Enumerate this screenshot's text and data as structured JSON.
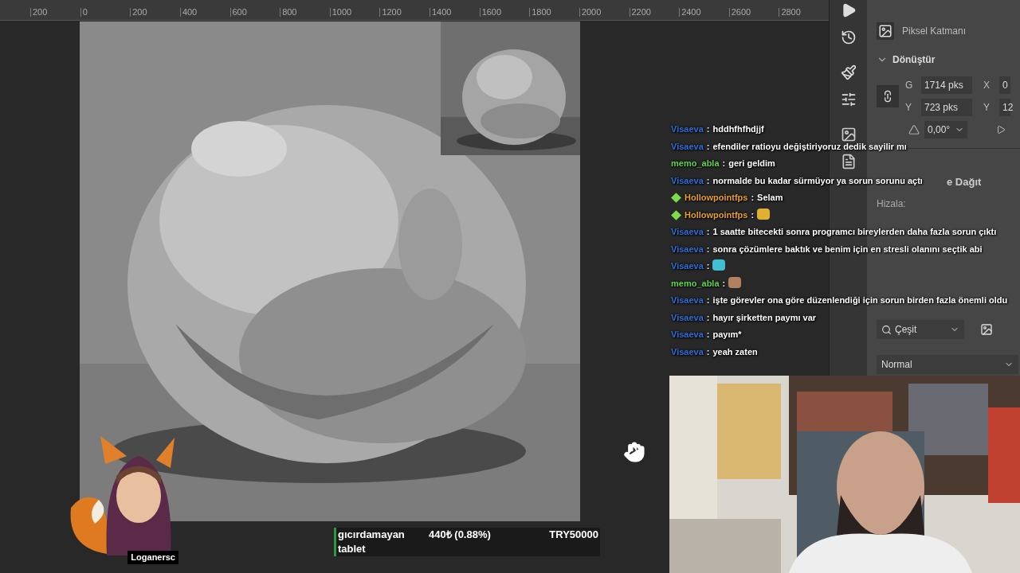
{
  "ruler": {
    "labels": [
      "200",
      "0",
      "200",
      "400",
      "600",
      "800",
      "1000",
      "1200",
      "1400",
      "1600",
      "1800",
      "2000",
      "2200",
      "2400",
      "2600",
      "2800"
    ]
  },
  "properties_panel": {
    "layer_type": "Piksel Katmanı",
    "transform": {
      "title": "Dönüştür",
      "expanded": true,
      "fields": [
        {
          "label": "G",
          "value": "1714 pks"
        },
        {
          "label": "X",
          "value": "0"
        },
        {
          "label": "Y",
          "value": "723 pks"
        },
        {
          "label": "Y",
          "value": "12"
        }
      ],
      "angle": "0,00°"
    },
    "align_title": "e Dağıt",
    "align_label": "Hizala:"
  },
  "layers_panel": {
    "filter": "Çeşit",
    "blend_mode": "Normal"
  },
  "chat": {
    "separator": ":",
    "messages": [
      {
        "user": "Visaeva",
        "color": "#2f6fd6",
        "badge": false,
        "kind": "text",
        "text": "hddhfhfhdjjf"
      },
      {
        "user": "Visaeva",
        "color": "#2f6fd6",
        "badge": false,
        "kind": "text",
        "text": "efendiler ratioyu değiştiriyoruz dedik sayilir mı"
      },
      {
        "user": "memo_abla",
        "color": "#5ed64a",
        "badge": false,
        "kind": "text",
        "text": "geri geldim"
      },
      {
        "user": "Visaeva",
        "color": "#2f6fd6",
        "badge": false,
        "kind": "text",
        "text": "normalde bu kadar sürmüyor ya sorun sorunu açtı"
      },
      {
        "user": "Hollowpointfps",
        "color": "#e8a030",
        "badge": true,
        "kind": "text",
        "text": "Selam"
      },
      {
        "user": "Hollowpointfps",
        "color": "#e8a030",
        "badge": true,
        "kind": "emote"
      },
      {
        "user": "Visaeva",
        "color": "#2f6fd6",
        "badge": false,
        "kind": "text",
        "text": "1 saatte bitecekti sonra programcı bireylerden daha fazla sorun çıktı"
      },
      {
        "user": "Visaeva",
        "color": "#2f6fd6",
        "badge": false,
        "kind": "text",
        "text": "sonra çözümlere baktık ve benim için en stresli olanını seçtik abi"
      },
      {
        "user": "Visaeva",
        "color": "#2f6fd6",
        "badge": false,
        "kind": "emote"
      },
      {
        "user": "memo_abla",
        "color": "#5ed64a",
        "badge": false,
        "kind": "emote"
      },
      {
        "user": "Visaeva",
        "color": "#2f6fd6",
        "badge": false,
        "kind": "text",
        "text": "işte görevler ona göre düzenlendiği için sorun birden fazla önemli oldu"
      },
      {
        "user": "Visaeva",
        "color": "#2f6fd6",
        "badge": false,
        "kind": "text",
        "text": "hayır şirketten paymı var"
      },
      {
        "user": "Visaeva",
        "color": "#2f6fd6",
        "badge": false,
        "kind": "text",
        "text": "payım*"
      },
      {
        "user": "Visaeva",
        "color": "#2f6fd6",
        "badge": false,
        "kind": "text",
        "text": "yeah zaten"
      }
    ]
  },
  "avatar": {
    "name": "Loganersc"
  },
  "donation_goal": {
    "title": "gıcırdamayan tablet",
    "amount": "440₺ (0.88%)",
    "target": "TRY50000"
  }
}
